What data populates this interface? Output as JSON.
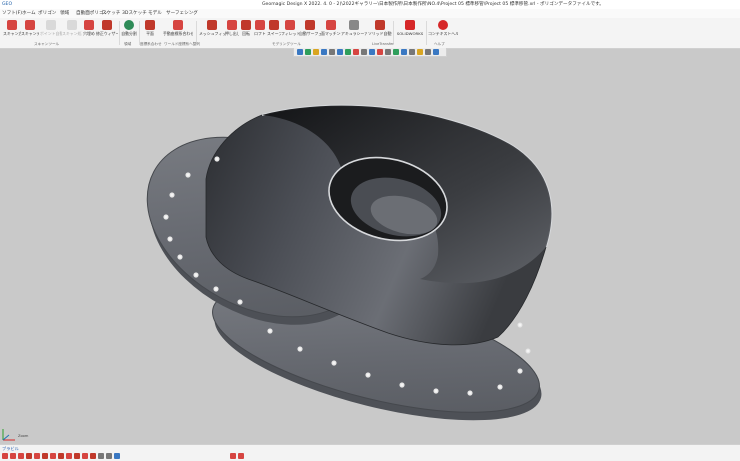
{
  "titlebar": {
    "logo": "GEO",
    "title": "Geomagic Design X 2022. 4. 0 - 2)\\2022ギャラリー\\日本製作所\\日本製作所\\NO.4\\Project 05 標準移管\\Project 05 標準移管.xrl - ポリゴンデータファイルです。"
  },
  "menu": {
    "items": [
      "ソフト(F)",
      "ホーム",
      "ポリゴン",
      "領域",
      "自動面ポリゴン",
      "スケッチ",
      "3Dスケッチ",
      "モデル",
      "サーフェシング"
    ]
  },
  "ribbon": {
    "tools": [
      {
        "label": "スキャン方式",
        "color": "#d64541",
        "dim": false
      },
      {
        "label": "スキャンデータ",
        "color": "#d64541",
        "dim": false
      },
      {
        "label": "ポイント自動スキャン",
        "color": "#bbbbbb",
        "dim": true
      },
      {
        "label": "スキャン処理",
        "color": "#bbbbbb",
        "dim": true
      },
      {
        "label": "穴埋め",
        "color": "#d64541",
        "dim": false
      },
      {
        "label": "修正ウィザード",
        "color": "#c0392b",
        "dim": false
      },
      {
        "label": "自動分割",
        "color": "#2e8b57",
        "dim": false
      },
      {
        "label": "平面",
        "color": "#c0392b",
        "dim": false
      },
      {
        "label": "手動座標系合わせ",
        "color": "#d64541",
        "dim": false
      },
      {
        "label": "メッシュフィット",
        "color": "#c0392b",
        "dim": false
      },
      {
        "label": "押し出し",
        "color": "#d64541",
        "dim": false
      },
      {
        "label": "回転",
        "color": "#c0392b",
        "dim": false
      },
      {
        "label": "ロフト",
        "color": "#d64541",
        "dim": false
      },
      {
        "label": "スイープ",
        "color": "#c0392b",
        "dim": false
      },
      {
        "label": "フィレット",
        "color": "#d64541",
        "dim": false
      },
      {
        "label": "自動サーフェス",
        "color": "#c0392b",
        "dim": false
      },
      {
        "label": "面マッチング",
        "color": "#d64541",
        "dim": false
      },
      {
        "label": "アキュラシーアナライザ",
        "color": "#888888",
        "dim": false
      },
      {
        "label": "ソリッド自動生成",
        "color": "#c0392b",
        "dim": false
      },
      {
        "label": "SOLIDWORKS",
        "color": "#d62728",
        "dim": false
      },
      {
        "label": "コンテキストヘルプ",
        "color": "#d62728",
        "dim": false
      }
    ],
    "groups": [
      "スキャンツール",
      "領域",
      "座標系合わせ",
      "ワールド座標系へ整列",
      "モデリングツール",
      "LiveTransfer",
      "ヘルプ"
    ]
  },
  "viewport": {
    "model": "flanged-pipe-transition-3d-model",
    "background": "#c9c9c9"
  },
  "axis": {
    "label": "Zoom"
  },
  "status": {
    "text": "ブラビル"
  }
}
